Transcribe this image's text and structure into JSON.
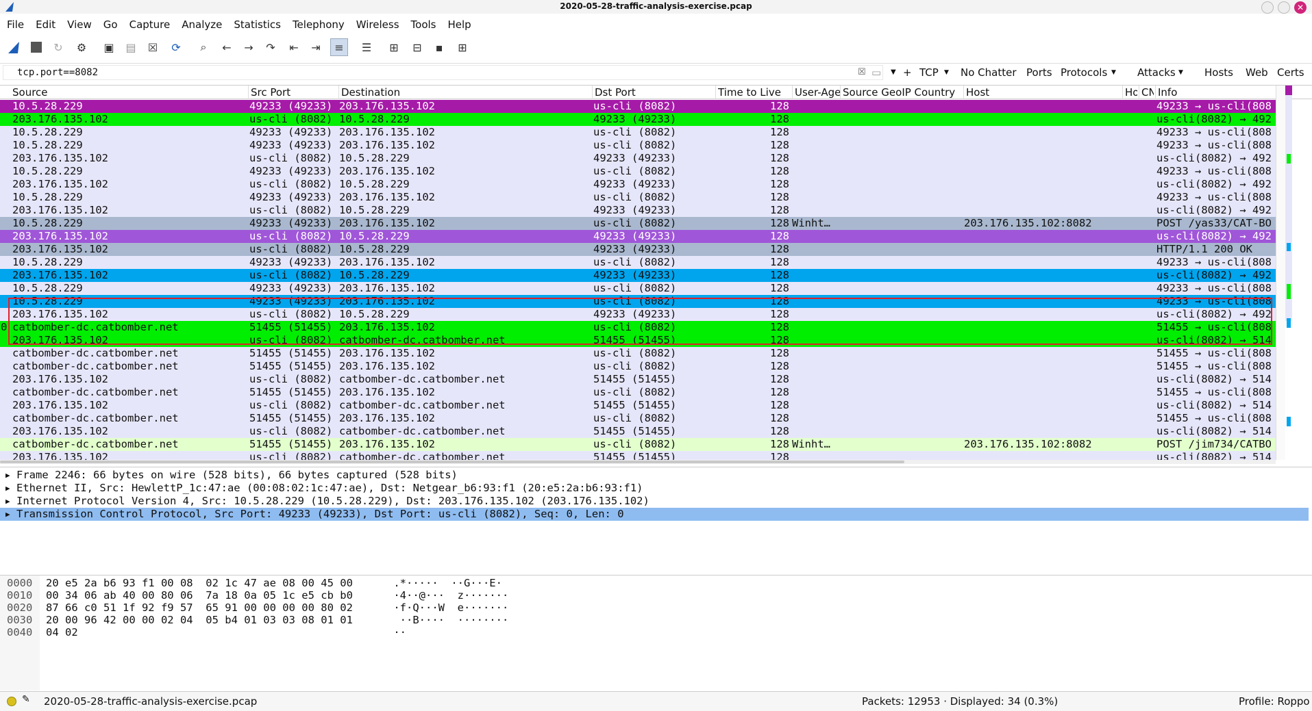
{
  "window": {
    "title": "2020-05-28-traffic-analysis-exercise.pcap"
  },
  "menu": [
    "File",
    "Edit",
    "View",
    "Go",
    "Capture",
    "Analyze",
    "Statistics",
    "Telephony",
    "Wireless",
    "Tools",
    "Help"
  ],
  "filter": {
    "value": "tcp.port==8082",
    "buttons": [
      "TCP",
      "No Chatter",
      "Ports",
      "Protocols",
      "Attacks",
      "Hosts",
      "Web",
      "Certs"
    ]
  },
  "columns": [
    "Source",
    "Src Port",
    "Destination",
    "Dst Port",
    "Time to Live",
    "User-Ager",
    "Source GeoIP Country",
    "Host",
    "Ho:",
    "CN",
    "Info"
  ],
  "colors": {
    "magenta": "#a61aa8",
    "green": "#00ee00",
    "lavender": "#e6e6fa",
    "selected_gray": "#a9b8cf",
    "selected_purple": "#a056d8",
    "blue": "#00a5ee",
    "light_green": "#e2ffcc",
    "highlight_box": "#e0202a",
    "detail_highlight": "#8fbcf0"
  },
  "packets": [
    {
      "src": "10.5.28.229",
      "sport": "49233 (49233)",
      "dst": "203.176.135.102",
      "dport": "us-cli (8082)",
      "ttl": "128",
      "ua": "",
      "host": "",
      "info": "49233 → us-cli(808",
      "color": "magenta"
    },
    {
      "src": "203.176.135.102",
      "sport": "us-cli (8082)",
      "dst": "10.5.28.229",
      "dport": "49233 (49233)",
      "ttl": "128",
      "ua": "",
      "host": "",
      "info": "us-cli(8082) → 492",
      "color": "green"
    },
    {
      "src": "10.5.28.229",
      "sport": "49233 (49233)",
      "dst": "203.176.135.102",
      "dport": "us-cli (8082)",
      "ttl": "128",
      "ua": "",
      "host": "",
      "info": "49233 → us-cli(808",
      "color": "lavender"
    },
    {
      "src": "10.5.28.229",
      "sport": "49233 (49233)",
      "dst": "203.176.135.102",
      "dport": "us-cli (8082)",
      "ttl": "128",
      "ua": "",
      "host": "",
      "info": "49233 → us-cli(808",
      "color": "lavender"
    },
    {
      "src": "203.176.135.102",
      "sport": "us-cli (8082)",
      "dst": "10.5.28.229",
      "dport": "49233 (49233)",
      "ttl": "128",
      "ua": "",
      "host": "",
      "info": "us-cli(8082) → 492",
      "color": "lavender"
    },
    {
      "src": "10.5.28.229",
      "sport": "49233 (49233)",
      "dst": "203.176.135.102",
      "dport": "us-cli (8082)",
      "ttl": "128",
      "ua": "",
      "host": "",
      "info": "49233 → us-cli(808",
      "color": "lavender"
    },
    {
      "src": "203.176.135.102",
      "sport": "us-cli (8082)",
      "dst": "10.5.28.229",
      "dport": "49233 (49233)",
      "ttl": "128",
      "ua": "",
      "host": "",
      "info": "us-cli(8082) → 492",
      "color": "lavender"
    },
    {
      "src": "10.5.28.229",
      "sport": "49233 (49233)",
      "dst": "203.176.135.102",
      "dport": "us-cli (8082)",
      "ttl": "128",
      "ua": "",
      "host": "",
      "info": "49233 → us-cli(808",
      "color": "lavender"
    },
    {
      "src": "203.176.135.102",
      "sport": "us-cli (8082)",
      "dst": "10.5.28.229",
      "dport": "49233 (49233)",
      "ttl": "128",
      "ua": "",
      "host": "",
      "info": "us-cli(8082) → 492",
      "color": "lavender"
    },
    {
      "src": "10.5.28.229",
      "sport": "49233 (49233)",
      "dst": "203.176.135.102",
      "dport": "us-cli (8082)",
      "ttl": "128",
      "ua": "Winht…",
      "host": "203.176.135.102:8082",
      "info": "POST /yas33/CAT-BO",
      "color": "selected_gray"
    },
    {
      "src": "203.176.135.102",
      "sport": "us-cli (8082)",
      "dst": "10.5.28.229",
      "dport": "49233 (49233)",
      "ttl": "128",
      "ua": "",
      "host": "",
      "info": "us-cli(8082) → 492",
      "color": "selected_purple"
    },
    {
      "src": "203.176.135.102",
      "sport": "us-cli (8082)",
      "dst": "10.5.28.229",
      "dport": "49233 (49233)",
      "ttl": "128",
      "ua": "",
      "host": "",
      "info": "HTTP/1.1 200 OK",
      "color": "selected_gray"
    },
    {
      "src": "10.5.28.229",
      "sport": "49233 (49233)",
      "dst": "203.176.135.102",
      "dport": "us-cli (8082)",
      "ttl": "128",
      "ua": "",
      "host": "",
      "info": "49233 → us-cli(808",
      "color": "lavender"
    },
    {
      "src": "203.176.135.102",
      "sport": "us-cli (8082)",
      "dst": "10.5.28.229",
      "dport": "49233 (49233)",
      "ttl": "128",
      "ua": "",
      "host": "",
      "info": "us-cli(8082) → 492",
      "color": "blue"
    },
    {
      "src": "10.5.28.229",
      "sport": "49233 (49233)",
      "dst": "203.176.135.102",
      "dport": "us-cli (8082)",
      "ttl": "128",
      "ua": "",
      "host": "",
      "info": "49233 → us-cli(808",
      "color": "lavender"
    },
    {
      "src": "10.5.28.229",
      "sport": "49233 (49233)",
      "dst": "203.176.135.102",
      "dport": "us-cli (8082)",
      "ttl": "128",
      "ua": "",
      "host": "",
      "info": "49233 → us-cli(808",
      "color": "blue"
    },
    {
      "src": "203.176.135.102",
      "sport": "us-cli (8082)",
      "dst": "10.5.28.229",
      "dport": "49233 (49233)",
      "ttl": "128",
      "ua": "",
      "host": "",
      "info": "us-cli(8082) → 492",
      "color": "lavender"
    },
    {
      "src": "catbomber-dc.catbomber.net",
      "sport": "51455 (51455)",
      "dst": "203.176.135.102",
      "dport": "us-cli (8082)",
      "ttl": "128",
      "ua": "",
      "host": "",
      "info": "51455 → us-cli(808",
      "color": "green",
      "mark": "0"
    },
    {
      "src": "203.176.135.102",
      "sport": "us-cli (8082)",
      "dst": "catbomber-dc.catbomber.net",
      "dport": "51455 (51455)",
      "ttl": "128",
      "ua": "",
      "host": "",
      "info": "us-cli(8082) → 514",
      "color": "green"
    },
    {
      "src": "catbomber-dc.catbomber.net",
      "sport": "51455 (51455)",
      "dst": "203.176.135.102",
      "dport": "us-cli (8082)",
      "ttl": "128",
      "ua": "",
      "host": "",
      "info": "51455 → us-cli(808",
      "color": "lavender"
    },
    {
      "src": "catbomber-dc.catbomber.net",
      "sport": "51455 (51455)",
      "dst": "203.176.135.102",
      "dport": "us-cli (8082)",
      "ttl": "128",
      "ua": "",
      "host": "",
      "info": "51455 → us-cli(808",
      "color": "lavender"
    },
    {
      "src": "203.176.135.102",
      "sport": "us-cli (8082)",
      "dst": "catbomber-dc.catbomber.net",
      "dport": "51455 (51455)",
      "ttl": "128",
      "ua": "",
      "host": "",
      "info": "us-cli(8082) → 514",
      "color": "lavender"
    },
    {
      "src": "catbomber-dc.catbomber.net",
      "sport": "51455 (51455)",
      "dst": "203.176.135.102",
      "dport": "us-cli (8082)",
      "ttl": "128",
      "ua": "",
      "host": "",
      "info": "51455 → us-cli(808",
      "color": "lavender"
    },
    {
      "src": "203.176.135.102",
      "sport": "us-cli (8082)",
      "dst": "catbomber-dc.catbomber.net",
      "dport": "51455 (51455)",
      "ttl": "128",
      "ua": "",
      "host": "",
      "info": "us-cli(8082) → 514",
      "color": "lavender"
    },
    {
      "src": "catbomber-dc.catbomber.net",
      "sport": "51455 (51455)",
      "dst": "203.176.135.102",
      "dport": "us-cli (8082)",
      "ttl": "128",
      "ua": "",
      "host": "",
      "info": "51455 → us-cli(808",
      "color": "lavender"
    },
    {
      "src": "203.176.135.102",
      "sport": "us-cli (8082)",
      "dst": "catbomber-dc.catbomber.net",
      "dport": "51455 (51455)",
      "ttl": "128",
      "ua": "",
      "host": "",
      "info": "us-cli(8082) → 514",
      "color": "lavender"
    },
    {
      "src": "catbomber-dc.catbomber.net",
      "sport": "51455 (51455)",
      "dst": "203.176.135.102",
      "dport": "us-cli (8082)",
      "ttl": "128",
      "ua": "Winht…",
      "host": "203.176.135.102:8082",
      "info": "POST /jim734/CATBO",
      "color": "light_green"
    },
    {
      "src": "203.176.135.102",
      "sport": "us-cli (8082)",
      "dst": "catbomber-dc.catbomber.net",
      "dport": "51455 (51455)",
      "ttl": "128",
      "ua": "",
      "host": "",
      "info": "us-cli(8082) → 514",
      "color": "lavender"
    }
  ],
  "details": [
    "Frame 2246: 66 bytes on wire (528 bits), 66 bytes captured (528 bits)",
    "Ethernet II, Src: HewlettP_1c:47:ae (00:08:02:1c:47:ae), Dst: Netgear_b6:93:f1 (20:e5:2a:b6:93:f1)",
    "Internet Protocol Version 4, Src: 10.5.28.229 (10.5.28.229), Dst: 203.176.135.102 (203.176.135.102)",
    "Transmission Control Protocol, Src Port: 49233 (49233), Dst Port: us-cli (8082), Seq: 0, Len: 0"
  ],
  "bytes": [
    {
      "off": "0000",
      "hex": "20 e5 2a b6 93 f1 00 08  02 1c 47 ae 08 00 45 00",
      "ascii": " .*·····  ··G···E·"
    },
    {
      "off": "0010",
      "hex": "00 34 06 ab 40 00 80 06  7a 18 0a 05 1c e5 cb b0",
      "ascii": " ·4··@···  z·······"
    },
    {
      "off": "0020",
      "hex": "87 66 c0 51 1f 92 f9 57  65 91 00 00 00 00 80 02",
      "ascii": " ·f·Q···W  e·······"
    },
    {
      "off": "0030",
      "hex": "20 00 96 42 00 00 02 04  05 b4 01 03 03 08 01 01",
      "ascii": "  ··B····  ········"
    },
    {
      "off": "0040",
      "hex": "04 02",
      "ascii": " ··"
    }
  ],
  "status": {
    "file": "2020-05-28-traffic-analysis-exercise.pcap",
    "packets": "Packets: 12953 · Displayed: 34 (0.3%)",
    "profile": "Profile: Roppo"
  }
}
